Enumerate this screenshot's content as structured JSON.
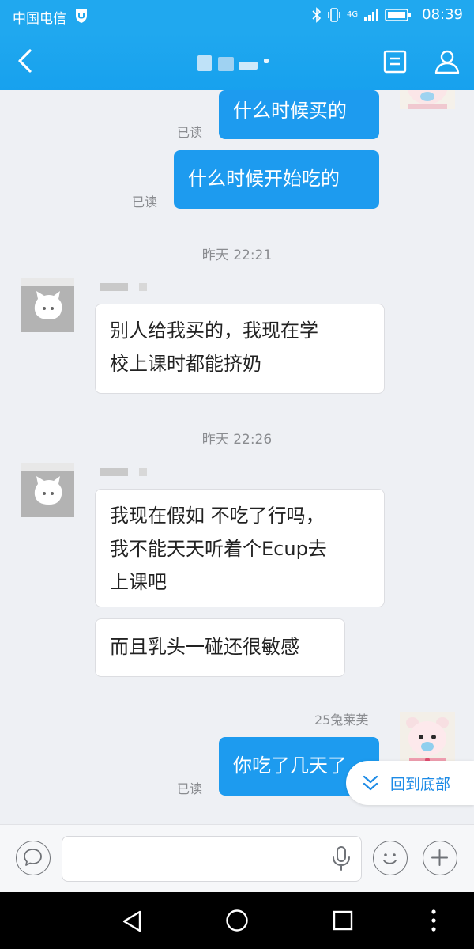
{
  "status_bar": {
    "carrier": "中国电信",
    "network": "4G",
    "time": "08:39"
  },
  "header": {
    "contact_name": ""
  },
  "messages": {
    "m1": {
      "text": "什么时候买的",
      "read": "已读"
    },
    "m2": {
      "text": "什么时候开始吃的",
      "read": "已读"
    },
    "ts1": "昨天 22:21",
    "m3": {
      "line1": "别人给我买的，我现在学",
      "line2": "校上课时都能挤奶"
    },
    "ts2": "昨天 22:26",
    "m4": {
      "line1": "我现在假如 不吃了行吗，",
      "line2": "我不能天天听着个Ecup去",
      "line3": "上课吧"
    },
    "m5": {
      "text": "而且乳头一碰还很敏感"
    },
    "m6": {
      "sender": "25兔莱芙",
      "text": "你吃了几天了",
      "read": "已读"
    }
  },
  "back_to_bottom": {
    "label": "回到底部"
  },
  "input": {
    "placeholder": ""
  },
  "colors": {
    "brand_blue": "#20a8ef",
    "outgoing_bubble": "#1d9bef",
    "link_blue": "#1d8be6"
  }
}
